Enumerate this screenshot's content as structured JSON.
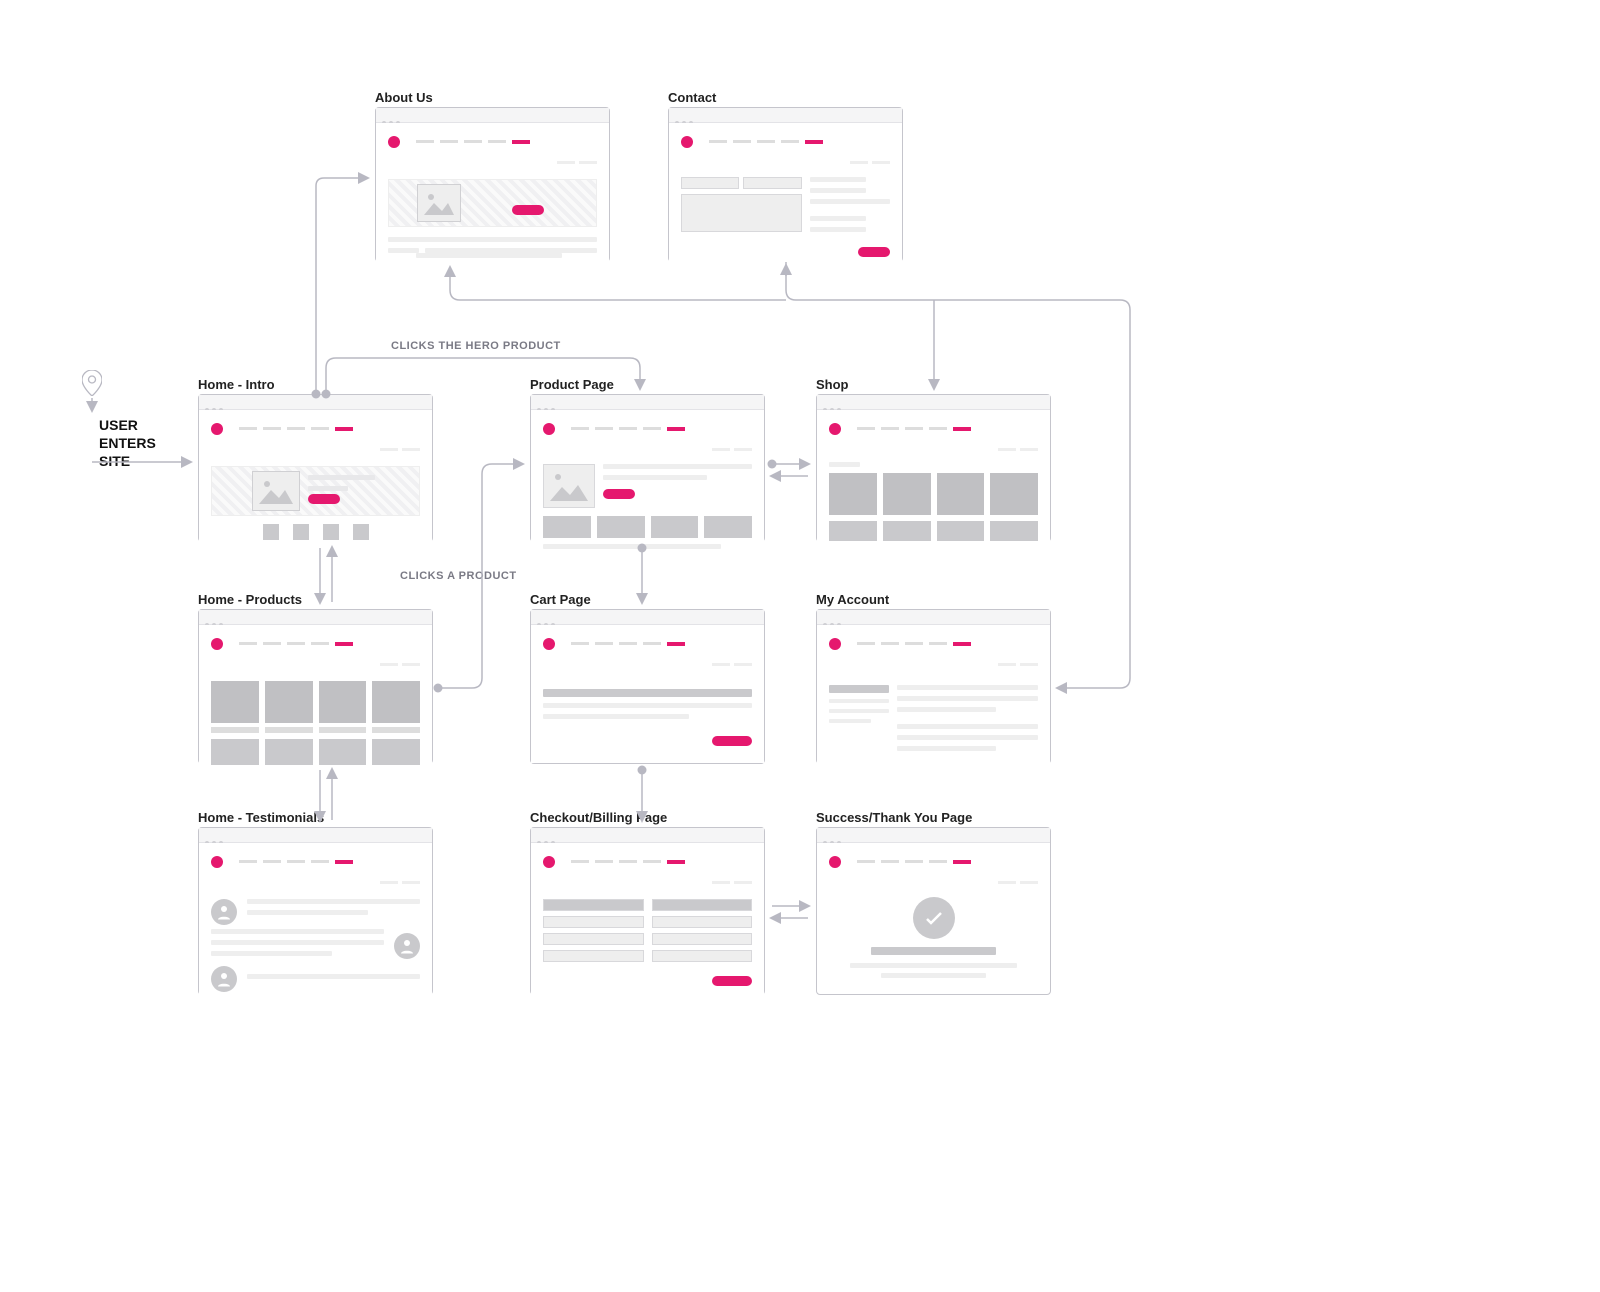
{
  "entry_label": "USER\nENTERS\nSITE",
  "captions": {
    "hero_click": "CLICKS THE HERO PRODUCT",
    "product_click": "CLICKS A PRODUCT"
  },
  "pages": {
    "about": {
      "title": "About Us"
    },
    "contact": {
      "title": "Contact"
    },
    "home_intro": {
      "title": "Home - Intro"
    },
    "product_page": {
      "title": "Product Page"
    },
    "shop": {
      "title": "Shop"
    },
    "home_products": {
      "title": "Home - Products"
    },
    "cart": {
      "title": "Cart Page"
    },
    "my_account": {
      "title": "My Account"
    },
    "home_test": {
      "title": "Home - Testimonials"
    },
    "checkout": {
      "title": "Checkout/Billing Page"
    },
    "success": {
      "title": "Success/Thank You Page"
    }
  },
  "connections": [
    {
      "from": "entry",
      "to": "home_intro"
    },
    {
      "from": "home_intro",
      "to": "about",
      "via": "top"
    },
    {
      "from": "home_intro",
      "to": "product_page",
      "label": "hero_click"
    },
    {
      "from": "home_intro",
      "to": "home_products",
      "bidir": true
    },
    {
      "from": "home_products",
      "to": "home_test",
      "bidir": true
    },
    {
      "from": "home_products",
      "to": "product_page",
      "label": "product_click"
    },
    {
      "from": "product_page",
      "to": "shop",
      "bidir": true
    },
    {
      "from": "product_page",
      "to": "cart",
      "bidir": true
    },
    {
      "from": "cart",
      "to": "checkout",
      "bidir": true
    },
    {
      "from": "checkout",
      "to": "success",
      "bidir": true
    },
    {
      "from": "contact",
      "to": "all_top",
      "via": "top_bus"
    },
    {
      "from": "shop",
      "to": "top_bus"
    },
    {
      "from": "my_account",
      "to": "top_bus"
    }
  ],
  "colors": {
    "accent": "#e5186e",
    "stroke": "#b8b8c2"
  }
}
